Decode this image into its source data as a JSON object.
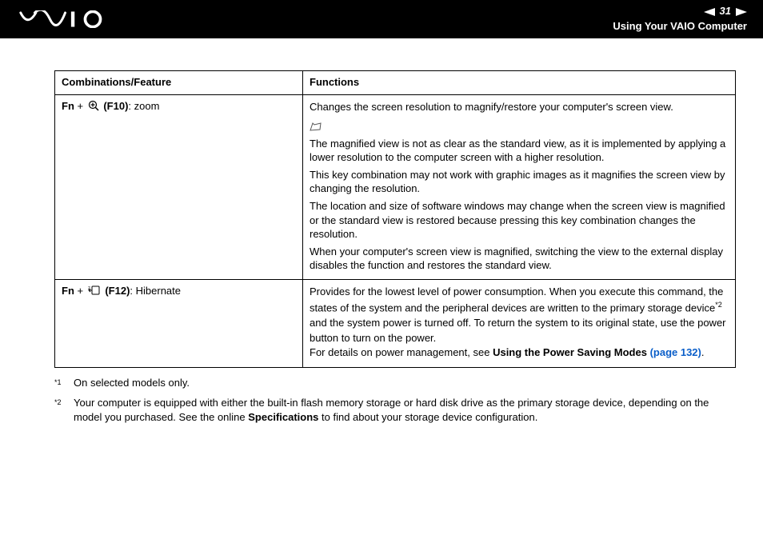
{
  "header": {
    "page_number": "31",
    "section_title": "Using Your VAIO Computer"
  },
  "table": {
    "head": {
      "col1": "Combinations/Feature",
      "col2": "Functions"
    },
    "row1": {
      "fn": "Fn",
      "plus": " + ",
      "key": "(F10)",
      "label": ": zoom",
      "desc_main": "Changes the screen resolution to magnify/restore your computer's screen view.",
      "note1": "The magnified view is not as clear as the standard view, as it is implemented by applying a lower resolution to the computer screen with a higher resolution.",
      "note2": "This key combination may not work with graphic images as it magnifies the screen view by changing the resolution.",
      "note3": "The location and size of software windows may change when the screen view is magnified or the standard view is restored because pressing this key combination changes the resolution.",
      "note4": "When your computer's screen view is magnified, switching the view to the external display disables the function and restores the standard view."
    },
    "row2": {
      "fn": "Fn",
      "plus": " + ",
      "key": "(F12)",
      "label": ": Hibernate",
      "desc1": "Provides for the lowest level of power consumption. When you execute this command, the states of the system and the peripheral devices are written to the primary storage device",
      "desc1b": " and the system power is turned off. To return the system to its original state, use the power button to turn on the power.",
      "desc2a": "For details on power management, see ",
      "desc2b": "Using the Power Saving Modes ",
      "desc2c": "(page 132)",
      "desc2d": "."
    }
  },
  "footnotes": {
    "f1_marker": "*1",
    "f1_text": "On selected models only.",
    "f2_marker": "*2",
    "f2_text_a": "Your computer is equipped with either the built-in flash memory storage or hard disk drive as the primary storage device, depending on the model you purchased. See the online ",
    "f2_text_b": "Specifications",
    "f2_text_c": " to find about your storage device configuration."
  }
}
